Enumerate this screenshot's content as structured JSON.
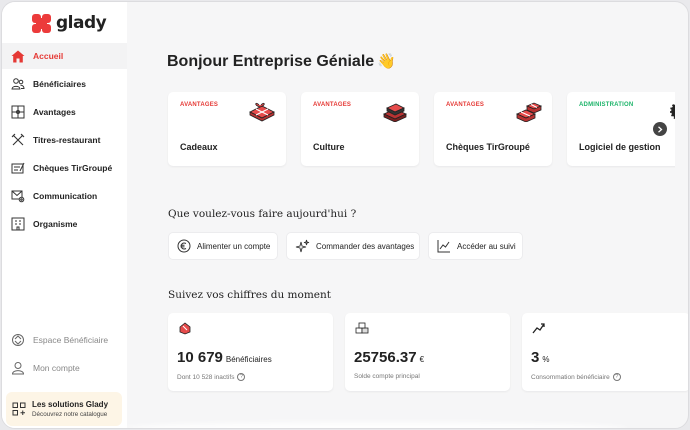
{
  "brand": {
    "name": "glady",
    "color": "#ec3b3b"
  },
  "sidebar": {
    "items": [
      {
        "label": "Accueil",
        "icon": "home-icon",
        "active": true
      },
      {
        "label": "Bénéficiaires",
        "icon": "users-icon"
      },
      {
        "label": "Avantages",
        "icon": "gift-box-icon"
      },
      {
        "label": "Titres-restaurant",
        "icon": "fork-knife-icon"
      },
      {
        "label": "Chèques TirGroupé",
        "icon": "cheque-icon"
      },
      {
        "label": "Communication",
        "icon": "mail-gear-icon"
      },
      {
        "label": "Organisme",
        "icon": "building-icon"
      }
    ],
    "bottom_items": [
      {
        "label": "Espace Bénéficiaire",
        "icon": "switch-space-icon"
      },
      {
        "label": "Mon compte",
        "icon": "user-icon"
      }
    ],
    "promo": {
      "title": "Les solutions Glady",
      "subtitle": "Découvrez notre catalogue",
      "icon": "grid-plus-icon"
    }
  },
  "main": {
    "greeting": "Bonjour Entreprise Géniale",
    "greeting_emoji": "👋",
    "cards": [
      {
        "tag": "AVANTAGES",
        "title": "Cadeaux",
        "tag_color": "#e53935",
        "icon": "gift-illustration"
      },
      {
        "tag": "AVANTAGES",
        "title": "Culture",
        "tag_color": "#e53935",
        "icon": "books-illustration"
      },
      {
        "tag": "AVANTAGES",
        "title": "Chèques TirGroupé",
        "tag_color": "#e53935",
        "icon": "gift-stack-illustration"
      },
      {
        "tag": "ADMINISTRATION",
        "title": "Logiciel de gestion",
        "tag_color": "#1db46a",
        "icon": "gear-illustration"
      }
    ],
    "actions_title": "Que voulez-vous faire aujourd'hui ?",
    "actions": [
      {
        "label": "Alimenter un compte",
        "icon": "euro-circle-icon"
      },
      {
        "label": "Commander des avantages",
        "icon": "sparkle-icon"
      },
      {
        "label": "Accéder au suivi",
        "icon": "chart-line-icon"
      }
    ],
    "stats_title": "Suivez vos chiffres du moment",
    "stats": [
      {
        "value": "10 679",
        "unit": "Bénéficiaires",
        "sub": "Dont 10 528 inactifs",
        "help": "?",
        "icon": "badge-icon"
      },
      {
        "value": "25756.37",
        "unit": "€",
        "sub": "Solde compte principal",
        "help": "",
        "icon": "coins-icon"
      },
      {
        "value": "3",
        "unit": "%",
        "sub": "Consommation bénéficiaire",
        "help": "?",
        "icon": "trend-up-icon"
      }
    ]
  }
}
